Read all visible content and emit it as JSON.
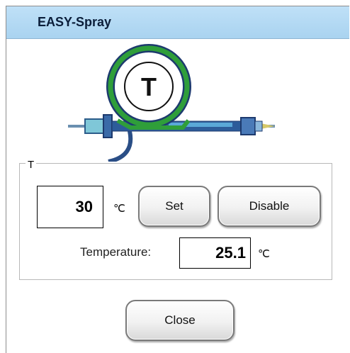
{
  "window": {
    "title": "EASY-Spray"
  },
  "device": {
    "badge": "T"
  },
  "group": {
    "label": "T"
  },
  "setpoint": {
    "value": "30",
    "unit": "℃"
  },
  "buttons": {
    "set": "Set",
    "disable": "Disable",
    "close": "Close"
  },
  "temperature": {
    "label": "Temperature:",
    "value": "25.1",
    "unit": "℃"
  },
  "colors": {
    "titlebar": "#b5daf4",
    "ring_green": "#2f9e3a",
    "ring_navy": "#1d3a6e"
  }
}
